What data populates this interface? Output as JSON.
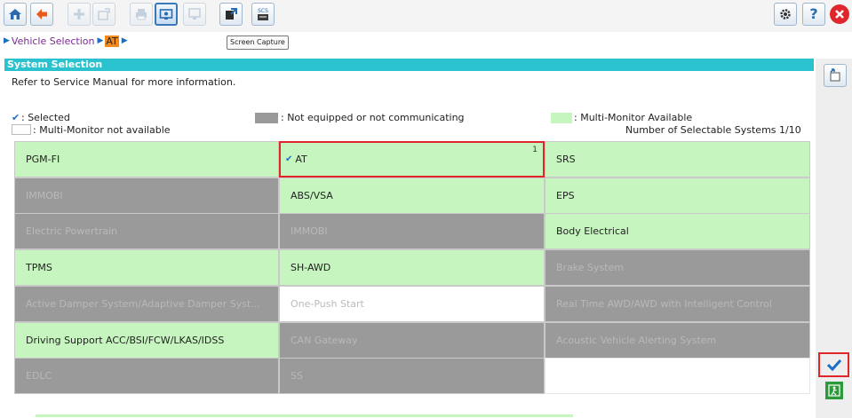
{
  "toolbar": {
    "left_buttons": [
      {
        "name": "home",
        "state": "enabled"
      },
      {
        "name": "back",
        "state": "enabled"
      },
      {
        "name": "add",
        "state": "disabled"
      },
      {
        "name": "edit",
        "state": "disabled"
      },
      {
        "name": "print",
        "state": "disabled"
      },
      {
        "name": "screen-capture",
        "state": "active"
      },
      {
        "name": "monitor",
        "state": "disabled"
      },
      {
        "name": "export",
        "state": "enabled"
      },
      {
        "name": "scs",
        "state": "enabled"
      }
    ],
    "scs_label": "SCS",
    "tooltip": "Screen Capture"
  },
  "breadcrumb": {
    "items": [
      "Vehicle Selection",
      "AT"
    ]
  },
  "section": {
    "title": "System Selection",
    "note": "Refer to Service Manual for more information."
  },
  "legend": {
    "selected": ": Selected",
    "not_equipped": ": Not equipped or not communicating",
    "multi_monitor": ": Multi-Monitor Available",
    "not_available": ": Multi-Monitor not available",
    "selectable_count": "Number of Selectable Systems 1/10"
  },
  "colors": {
    "header": "#2bc2d0",
    "green": "#c6f5bf",
    "gray": "#9a9a9a",
    "selected_border": "#e0252b",
    "accent": "#1a6ec5"
  },
  "systems": [
    {
      "label": "PGM-FI",
      "state": "green"
    },
    {
      "label": "AT",
      "state": "green",
      "selected": true,
      "count": "1"
    },
    {
      "label": "SRS",
      "state": "green"
    },
    {
      "label": "IMMOBI",
      "state": "gray"
    },
    {
      "label": "ABS/VSA",
      "state": "green"
    },
    {
      "label": "EPS",
      "state": "green"
    },
    {
      "label": "Electric Powertrain",
      "state": "gray"
    },
    {
      "label": "IMMOBI",
      "state": "gray"
    },
    {
      "label": "Body Electrical",
      "state": "green"
    },
    {
      "label": "TPMS",
      "state": "green"
    },
    {
      "label": "SH-AWD",
      "state": "green"
    },
    {
      "label": "Brake System",
      "state": "gray"
    },
    {
      "label": "Active Damper System/Adaptive Damper Syst...",
      "state": "gray"
    },
    {
      "label": "One-Push Start",
      "state": "white"
    },
    {
      "label": "Real Time AWD/AWD with Intelligent Control",
      "state": "gray"
    },
    {
      "label": "Driving Support  ACC/BSI/FCW/LKAS/IDSS",
      "state": "green"
    },
    {
      "label": "CAN Gateway",
      "state": "gray"
    },
    {
      "label": "Acoustic Vehicle Alerting System",
      "state": "gray"
    },
    {
      "label": "EDLC",
      "state": "gray"
    },
    {
      "label": "SS",
      "state": "gray"
    },
    {
      "label": "",
      "state": "blank"
    }
  ],
  "right_panel": {
    "buttons": [
      "settings",
      "help",
      "close",
      "vehicle-info",
      "confirm",
      "exit"
    ]
  }
}
